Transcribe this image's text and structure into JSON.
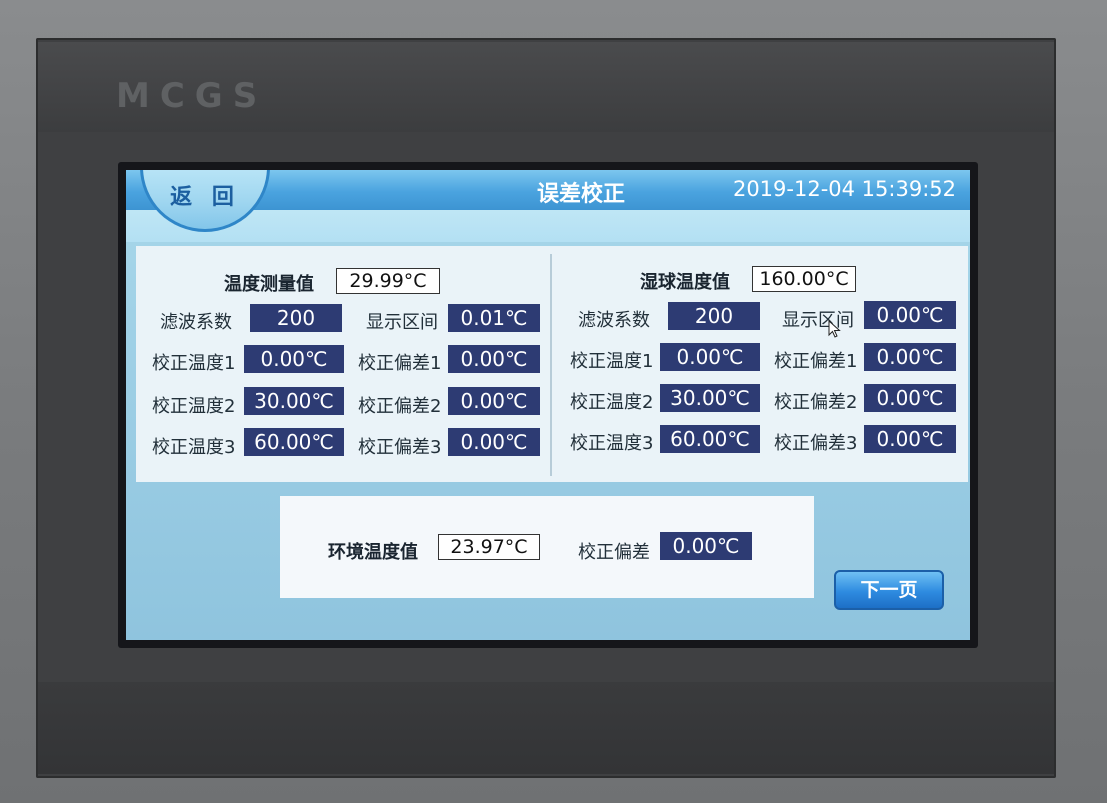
{
  "device": {
    "brand": "MCGS"
  },
  "header": {
    "back_label": "返 回",
    "title": "误差校正",
    "datetime": "2019-12-04 15:39:52"
  },
  "left": {
    "measure_label": "温度测量值",
    "measure_value": "29.99°C",
    "filter_label": "滤波系数",
    "filter_value": "200",
    "range_label": "显示区间",
    "range_value": "0.01℃",
    "rows": [
      {
        "temp_label": "校正温度1",
        "temp_value": "0.00℃",
        "dev_label": "校正偏差1",
        "dev_value": "0.00℃"
      },
      {
        "temp_label": "校正温度2",
        "temp_value": "30.00℃",
        "dev_label": "校正偏差2",
        "dev_value": "0.00℃"
      },
      {
        "temp_label": "校正温度3",
        "temp_value": "60.00℃",
        "dev_label": "校正偏差3",
        "dev_value": "0.00℃"
      }
    ]
  },
  "right": {
    "measure_label": "湿球温度值",
    "measure_value": "160.00°C",
    "filter_label": "滤波系数",
    "filter_value": "200",
    "range_label": "显示区间",
    "range_value": "0.00℃",
    "rows": [
      {
        "temp_label": "校正温度1",
        "temp_value": "0.00℃",
        "dev_label": "校正偏差1",
        "dev_value": "0.00℃"
      },
      {
        "temp_label": "校正温度2",
        "temp_value": "30.00℃",
        "dev_label": "校正偏差2",
        "dev_value": "0.00℃"
      },
      {
        "temp_label": "校正温度3",
        "temp_value": "60.00℃",
        "dev_label": "校正偏差3",
        "dev_value": "0.00℃"
      }
    ]
  },
  "ambient": {
    "label": "环境温度值",
    "value": "23.97°C",
    "dev_label": "校正偏差",
    "dev_value": "0.00℃"
  },
  "next_label": "下一页",
  "colors": {
    "header": "#3d94d2",
    "value_box": "#2d3b73",
    "screen_bg": "#a9d8ea"
  }
}
